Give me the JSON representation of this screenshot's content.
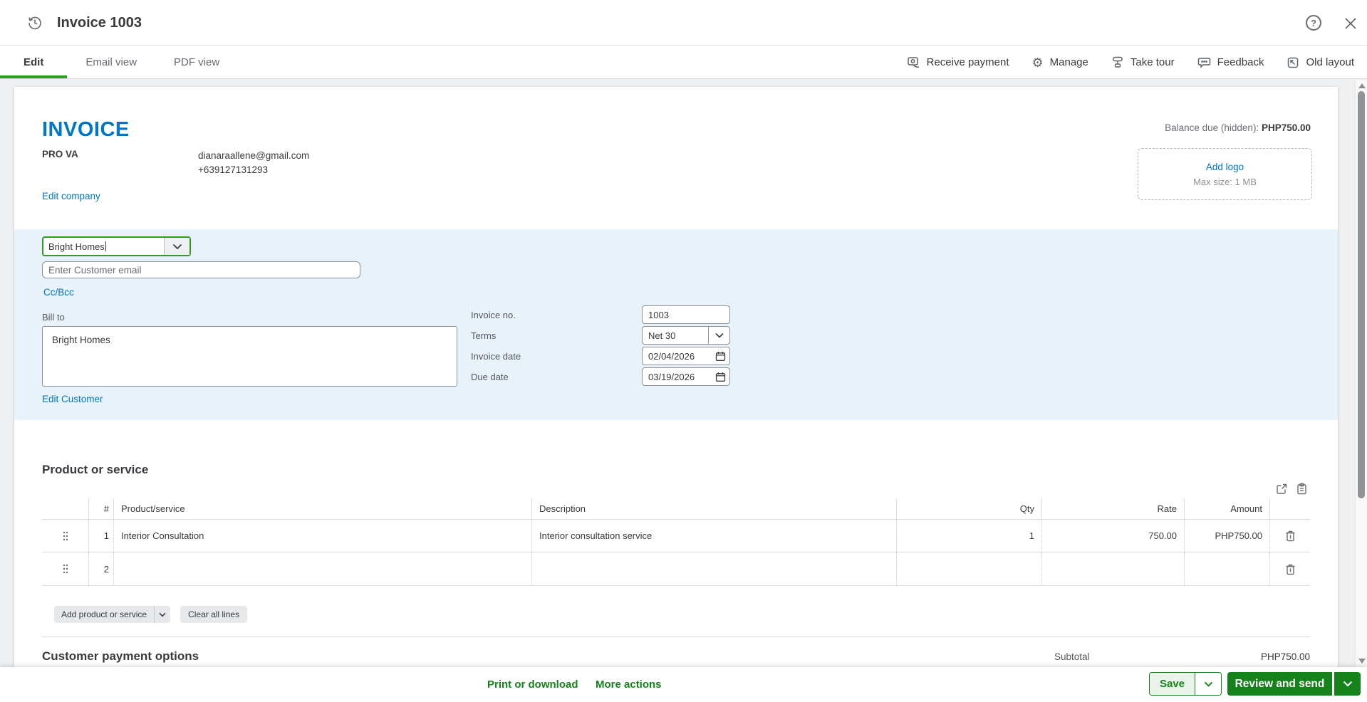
{
  "colors": {
    "accent_green": "#2ca01c",
    "action_green": "#15821b",
    "link_blue": "#0077c5",
    "customer_section_bg": "#e8f2fa"
  },
  "header": {
    "title": "Invoice 1003"
  },
  "icons": {
    "help_glyph": "?",
    "gear_glyph": "⚙"
  },
  "tabs": {
    "edit": "Edit",
    "email_view": "Email view",
    "pdf_view": "PDF view"
  },
  "toolbar": {
    "receive_payment": "Receive payment",
    "manage": "Manage",
    "take_tour": "Take tour",
    "feedback": "Feedback",
    "old_layout": "Old layout"
  },
  "invoice": {
    "heading": "INVOICE",
    "balance_label": "Balance due (hidden): ",
    "balance_value": "PHP750.00",
    "company_name": "PRO VA",
    "company_email": "dianaraallene@gmail.com",
    "company_phone": "+639127131293",
    "edit_company_label": "Edit company",
    "add_logo_label": "Add logo",
    "logo_max_size": "Max size: 1 MB"
  },
  "customer": {
    "name_value": "Bright Homes",
    "email_placeholder": "Enter Customer email",
    "ccbcc_label": "Cc/Bcc",
    "bill_to_label": "Bill to",
    "bill_to_value": "Bright Homes",
    "edit_customer_label": "Edit Customer",
    "fields": [
      {
        "label": "Invoice no.",
        "value": "1003",
        "type": "text"
      },
      {
        "label": "Terms",
        "value": "Net 30",
        "type": "select"
      },
      {
        "label": "Invoice date",
        "value": "02/04/2026",
        "type": "date"
      },
      {
        "label": "Due date",
        "value": "03/19/2026",
        "type": "date"
      }
    ]
  },
  "items": {
    "section_title": "Product or service",
    "columns": {
      "num": "#",
      "product": "Product/service",
      "description": "Description",
      "qty": "Qty",
      "rate": "Rate",
      "amount": "Amount"
    },
    "rows": [
      {
        "num": "1",
        "product": "Interior Consultation",
        "description": "Interior consultation service",
        "qty": "1",
        "rate": "750.00",
        "amount": "PHP750.00"
      },
      {
        "num": "2",
        "product": "",
        "description": "",
        "qty": "",
        "rate": "",
        "amount": ""
      }
    ],
    "add_button_label": "Add product or service",
    "clear_button_label": "Clear all lines"
  },
  "payment": {
    "section_title": "Customer payment options",
    "subtotal_label": "Subtotal",
    "subtotal_value": "PHP750.00"
  },
  "footer": {
    "print_label": "Print or download",
    "more_label": "More actions",
    "save_label": "Save",
    "review_label": "Review and send"
  }
}
